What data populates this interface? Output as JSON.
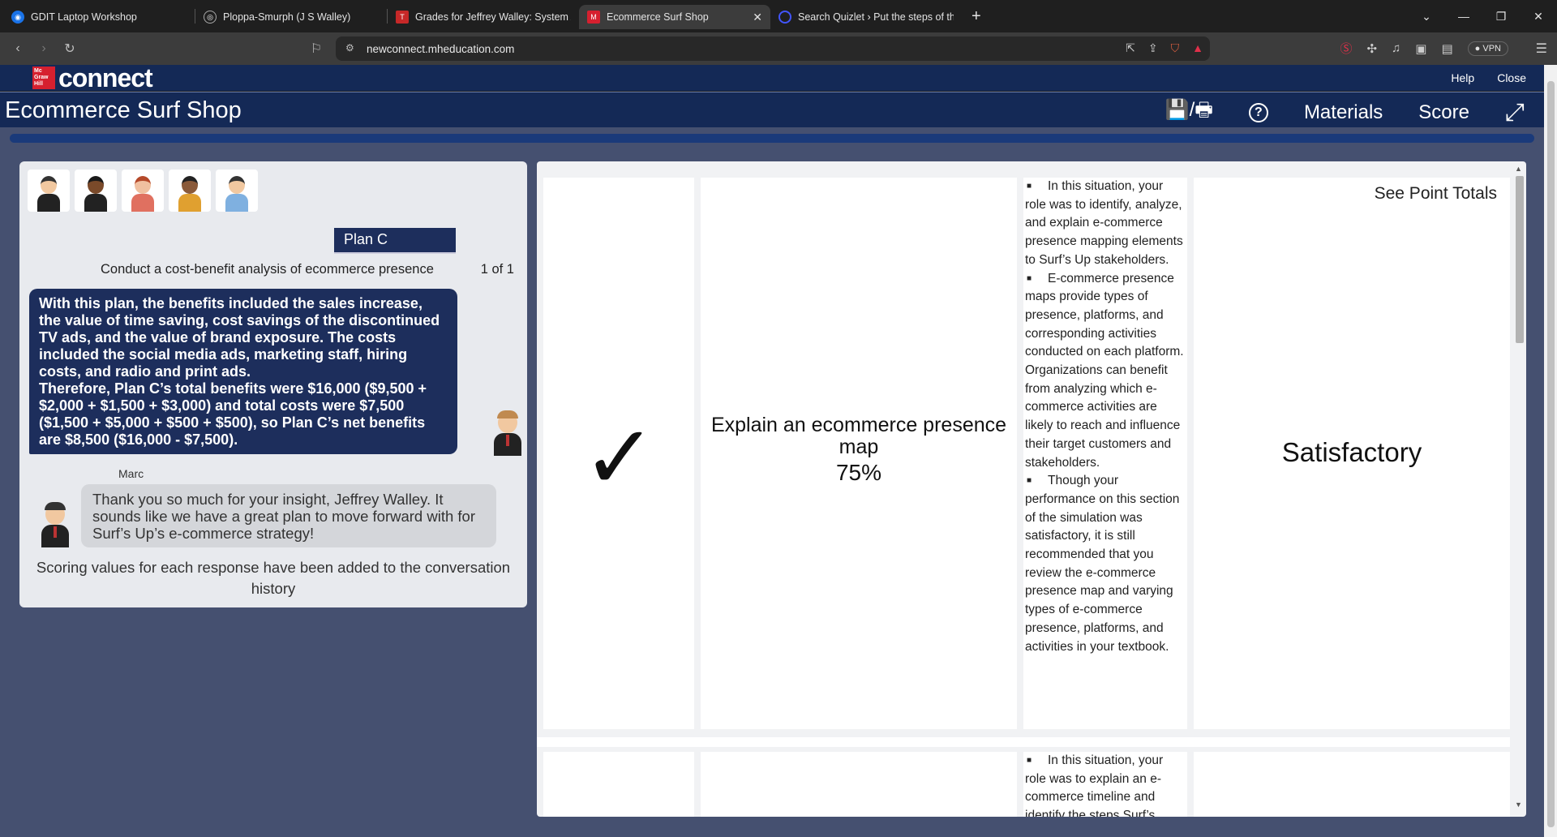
{
  "browser": {
    "tabs": [
      {
        "title": "GDIT Laptop Workshop",
        "color": "#1a73e8"
      },
      {
        "title": "Ploppa-Smurph (J S Walley)",
        "color": "#888888"
      },
      {
        "title": "Grades for Jeffrey Walley: System An",
        "color": "#c62828"
      },
      {
        "title": "Ecommerce Surf Shop",
        "color": "#d6202f"
      },
      {
        "title": "Search Quizlet › Put the steps of the",
        "color": "#4255ff"
      }
    ],
    "url": "newconnect.mheducation.com",
    "vpn_label": "VPN"
  },
  "mh": {
    "logo_text": "Mc Graw Hill",
    "product": "connect",
    "help": "Help",
    "close": "Close"
  },
  "app": {
    "title": "Ecommerce Surf Shop",
    "nav": {
      "save_print": "💾/🖶",
      "help_icon": "?",
      "materials": "Materials",
      "score": "Score",
      "expand": "⤢"
    }
  },
  "chat": {
    "plan_label": "Plan C",
    "subtitle": "Conduct a cost-benefit analysis of ecommerce presence",
    "counter": "1 of 1",
    "user_message": "With this plan, the benefits included the sales increase, the value of time saving, cost savings of the discontinued TV ads, and the value of brand exposure. The costs included the social media ads, marketing staff, hiring costs, and radio and print ads.\nTherefore, Plan C’s total benefits were $16,000 ($9,500 + $2,000 + $1,500 + $3,000) and total costs were $7,500 ($1,500 + $5,000 + $500 + $500), so Plan C’s net benefits are $8,500 ($16,000 - $7,500).",
    "reply_name": "Marc",
    "reply_message": "Thank you so much for your insight, Jeffrey Walley. It sounds like we have a great plan to move forward with for Surf’s Up’s e-commerce strategy!",
    "scoring_note": "Scoring values for each response have been added to the conversation history"
  },
  "results": {
    "rows": [
      {
        "status_icon": "✓",
        "skill": "Explain an ecommerce presence map",
        "percent": "75%",
        "feedback": [
          "In this situation, your role was to identify, analyze, and explain e-commerce presence mapping elements to Surf’s Up stakeholders.",
          "E-commerce presence maps provide types of presence, platforms, and corresponding activities conducted on each platform. Organizations can benefit from analyzing which e-commerce activities are likely to reach and influence their target customers and stakeholders.",
          "Though your performance on this section of the simulation was satisfactory, it is still recommended that you review the e-commerce presence map and varying types of e-commerce presence, platforms, and activities in your textbook."
        ],
        "see_totals": "See Point Totals",
        "rating": "Satisfactory"
      },
      {
        "feedback": [
          "In this situation, your role was to explain an e-commerce timeline and identify the steps Surf’s"
        ]
      }
    ]
  }
}
